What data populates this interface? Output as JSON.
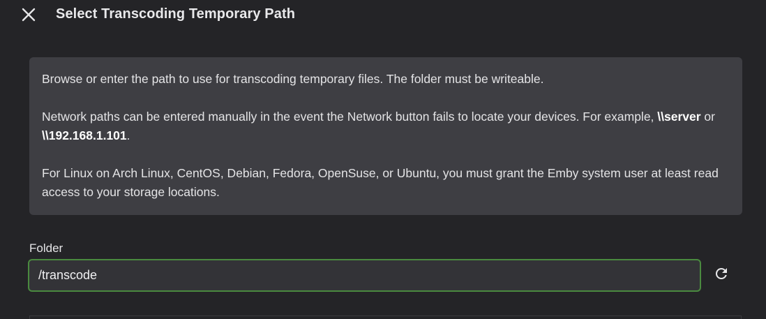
{
  "header": {
    "close_icon": "close-icon",
    "title": "Select Transcoding Temporary Path"
  },
  "info": {
    "p1": "Browse or enter the path to use for transcoding temporary files. The folder must be writeable.",
    "p2_prefix": "Network paths can be entered manually in the event the Network button fails to locate your devices. For example, ",
    "p2_example1": "\\\\server",
    "p2_or": " or ",
    "p2_example2": "\\\\192.168.1.101",
    "p2_suffix": ".",
    "p3": "For Linux on Arch Linux, CentOS, Debian, Fedora, OpenSuse, or Ubuntu, you must grant the Emby system user at least read access to your storage locations."
  },
  "folder": {
    "label": "Folder",
    "value": "/transcode",
    "refresh_icon": "refresh-icon"
  },
  "colors": {
    "background": "#242427",
    "info_box": "#3e3e43",
    "input_border_focus": "#4a8a3f"
  }
}
